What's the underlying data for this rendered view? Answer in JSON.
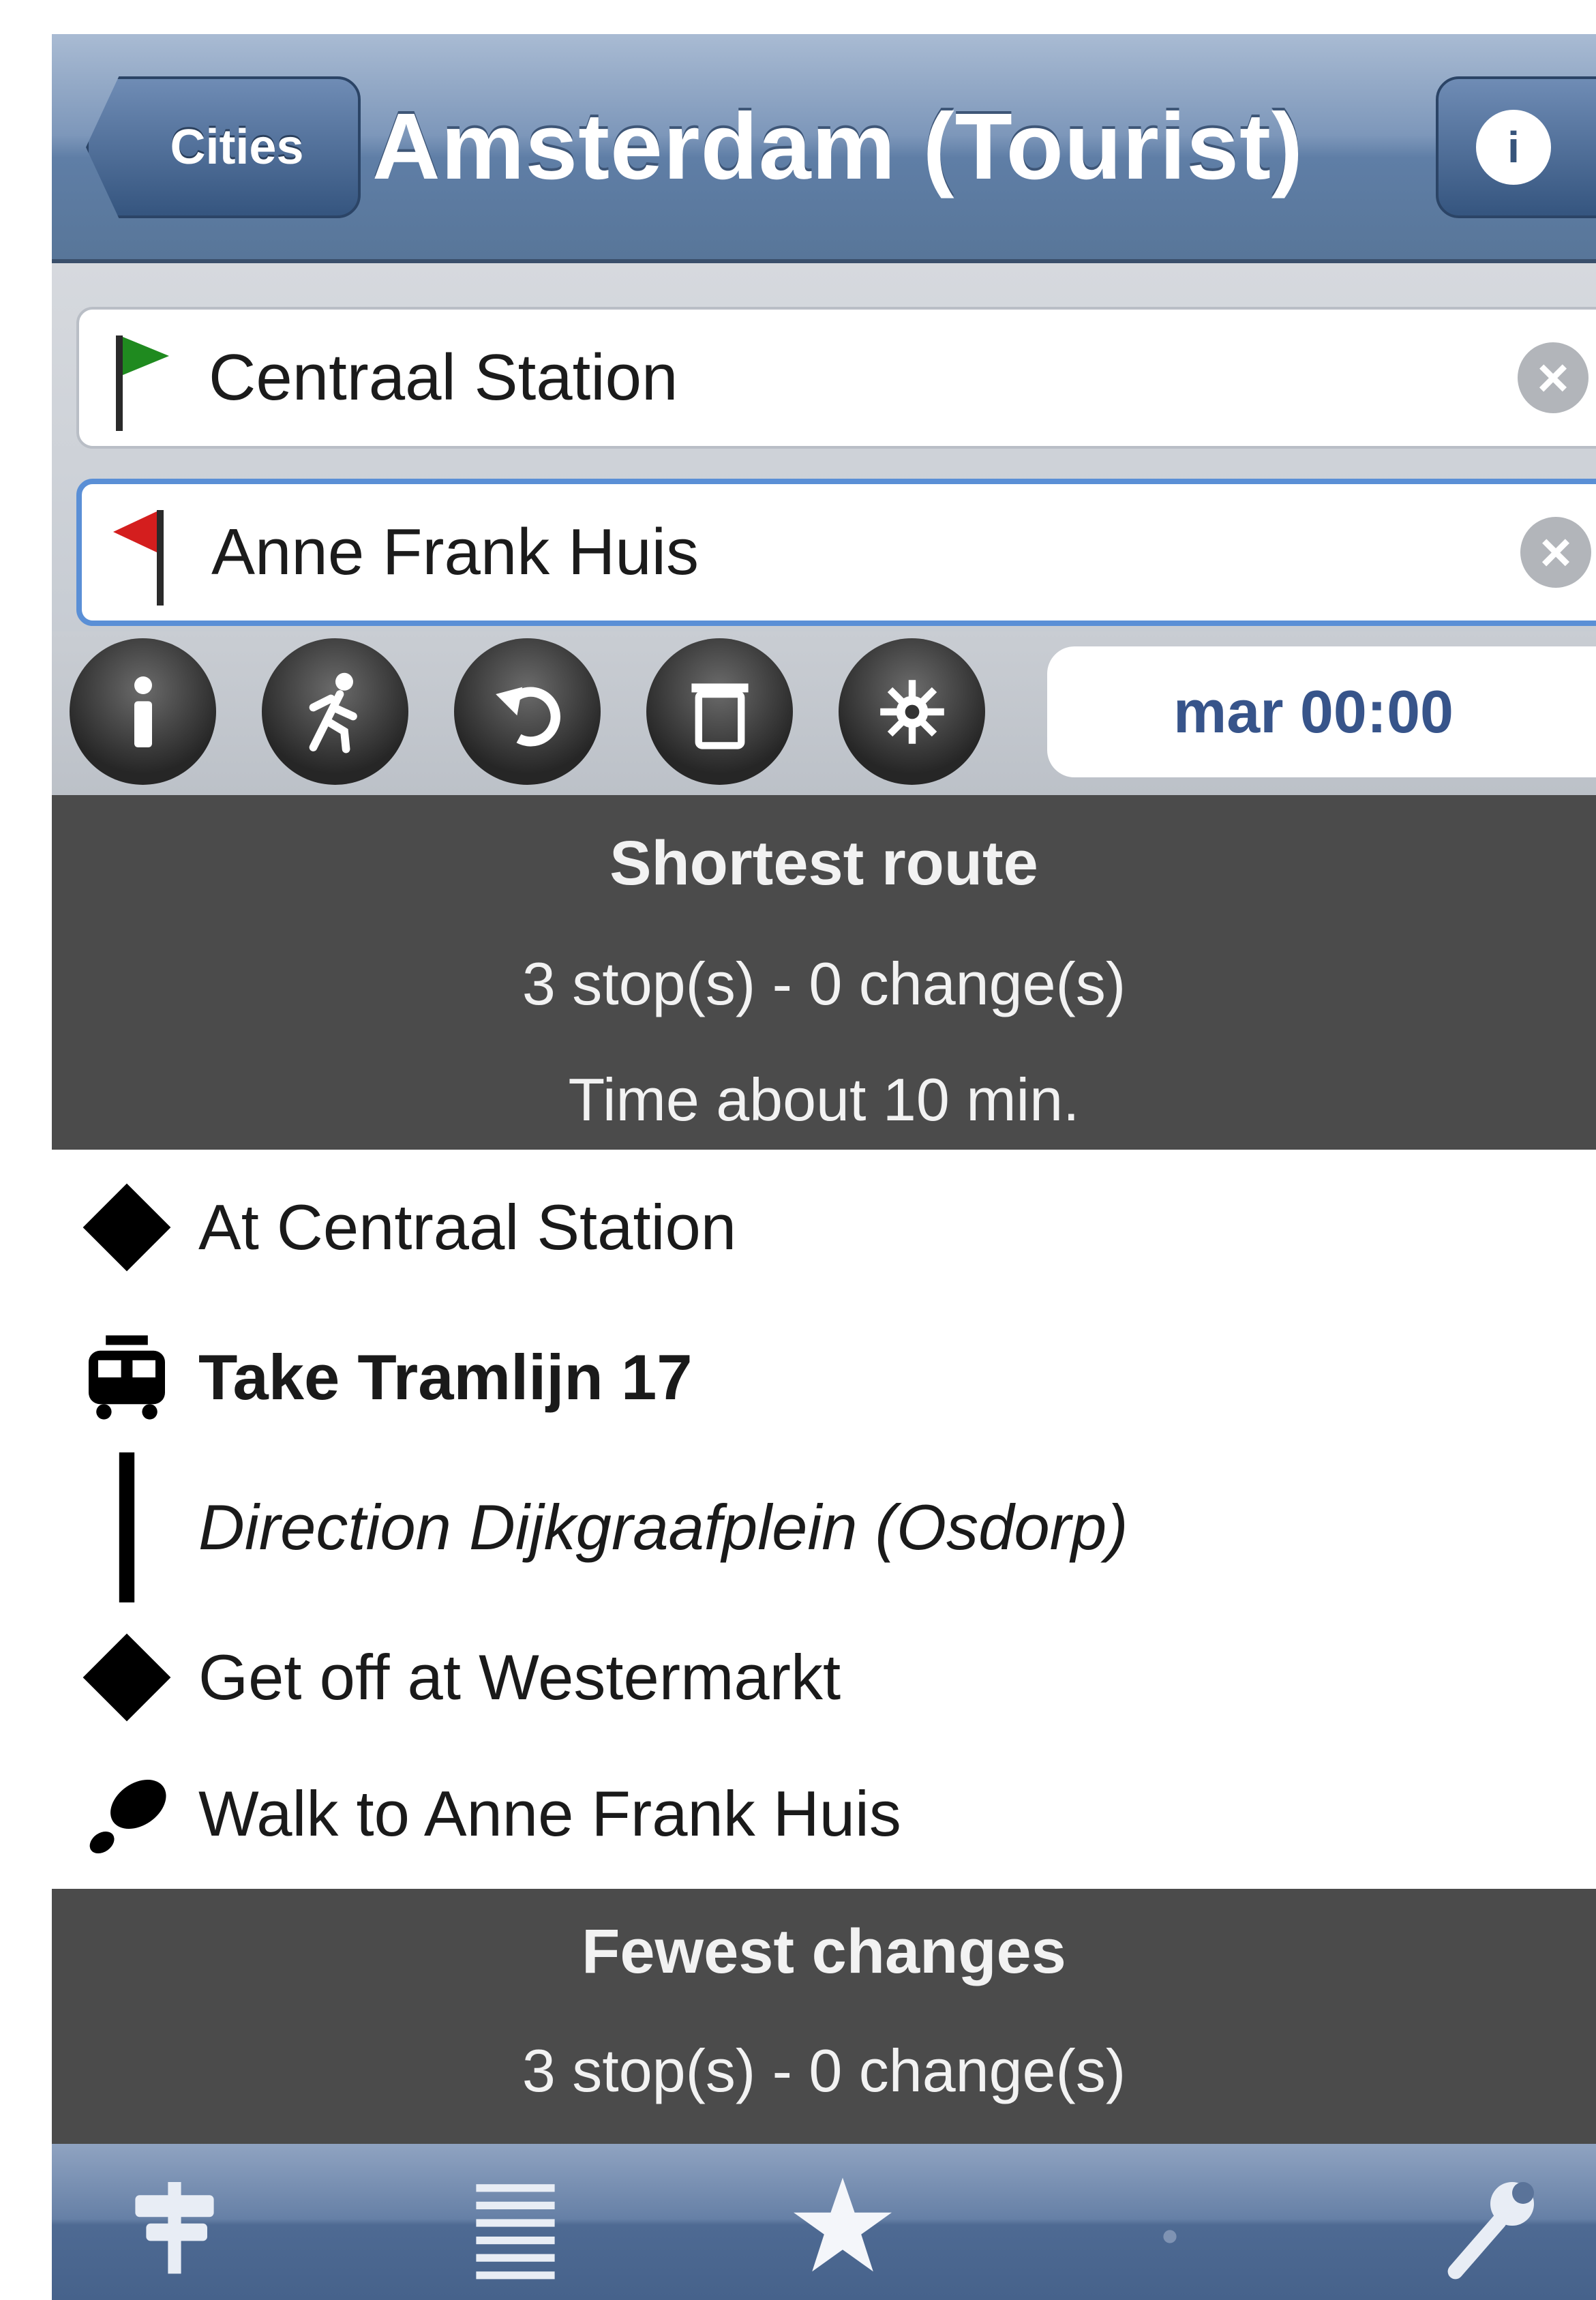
{
  "nav": {
    "back_label": "Cities",
    "title": "Amsterdam (Tourist)",
    "info_icon": "info-icon"
  },
  "inputs": {
    "from": {
      "value": "Centraal Station",
      "icon": "green-flag-icon"
    },
    "to": {
      "value": "Anne Frank Huis",
      "icon": "red-flag-icon"
    }
  },
  "toolbar": {
    "buttons": [
      "info-icon",
      "walk-icon",
      "return-icon",
      "trash-icon",
      "settings-icon"
    ],
    "time": "mar 00:00"
  },
  "routes": [
    {
      "title": "Shortest route",
      "summary": "3 stop(s) - 0 change(s)",
      "time": "Time about 10 min.",
      "steps": [
        {
          "icon": "diamond-icon",
          "text": "At Centraal Station"
        },
        {
          "icon": "tram-icon",
          "text": "Take Tramlijn 17"
        },
        {
          "icon": "line-icon",
          "text": "Direction Dijkgraafplein (Osdorp)"
        },
        {
          "icon": "diamond-icon",
          "text": "Get off at Westermarkt"
        },
        {
          "icon": "shoe-icon",
          "text": "Walk to Anne Frank Huis"
        }
      ]
    },
    {
      "title": "Fewest changes",
      "summary": "3 stop(s) - 0 change(s)"
    }
  ],
  "tabbar": {
    "items": [
      "signpost-icon",
      "list-icon",
      "star-icon",
      "blank-icon",
      "wrench-icon"
    ]
  },
  "colors": {
    "nav_blue": "#5f7ea6",
    "header_dark": "#4b4b4b",
    "time_text": "#37548a",
    "flag_green": "#1f8a1f",
    "flag_red": "#d41e1e"
  }
}
